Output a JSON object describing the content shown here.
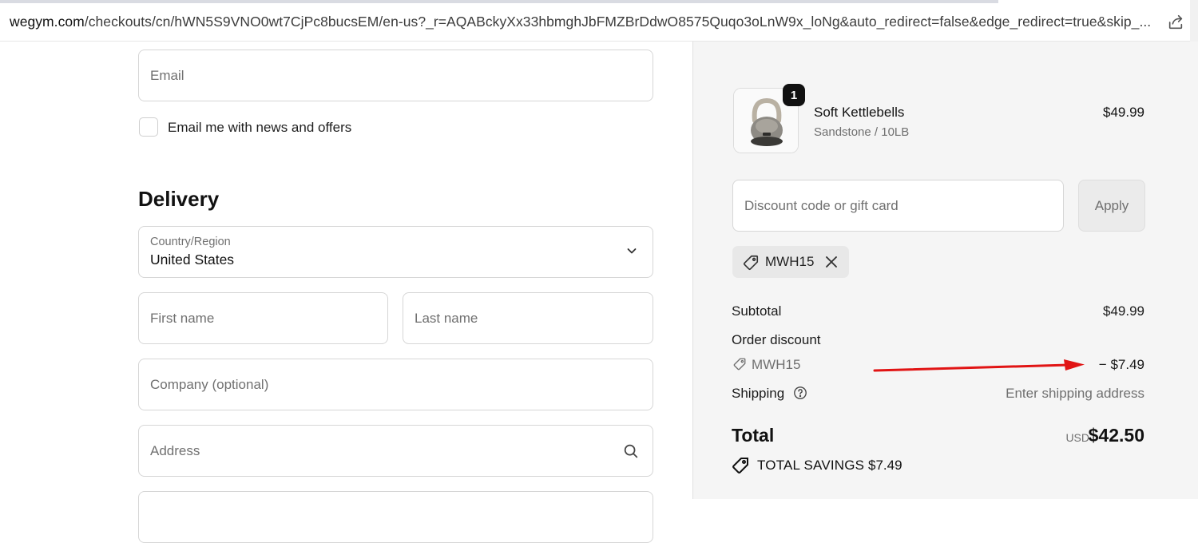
{
  "browser": {
    "url_host": "wegym.com",
    "url_path": "/checkouts/cn/hWN5S9VNO0wt7CjPc8bucsEM/en-us?_r=AQABckyXx33hbmghJbFMZBrDdwO8575Quqo3oLnW9x_loNg&auto_redirect=false&edge_redirect=true&skip_..."
  },
  "contact": {
    "email_placeholder": "Email",
    "newsletter_label": "Email me with news and offers"
  },
  "delivery": {
    "title": "Delivery",
    "country_label": "Country/Region",
    "country_value": "United States",
    "first_name_placeholder": "First name",
    "last_name_placeholder": "Last name",
    "company_placeholder": "Company (optional)",
    "address_placeholder": "Address"
  },
  "summary": {
    "item": {
      "qty": "1",
      "name": "Soft Kettlebells",
      "variant": "Sandstone / 10LB",
      "price": "$49.99"
    },
    "discount_placeholder": "Discount code or gift card",
    "apply_label": "Apply",
    "applied_code": "MWH15",
    "subtotal_label": "Subtotal",
    "subtotal_value": "$49.99",
    "order_discount_label": "Order discount",
    "discount_code": "MWH15",
    "discount_value": "− $7.49",
    "shipping_label": "Shipping",
    "shipping_value": "Enter shipping address",
    "total_label": "Total",
    "currency": "USD",
    "total_value": "$42.50",
    "savings_label": "TOTAL SAVINGS",
    "savings_value": "$7.49"
  },
  "colors": {
    "annotation_arrow": "#e11414",
    "summary_bg": "#f5f5f5"
  },
  "icons": [
    "share-icon",
    "chevron-down-icon",
    "search-icon",
    "tag-icon",
    "close-icon",
    "help-icon",
    "savings-tag-icon"
  ]
}
